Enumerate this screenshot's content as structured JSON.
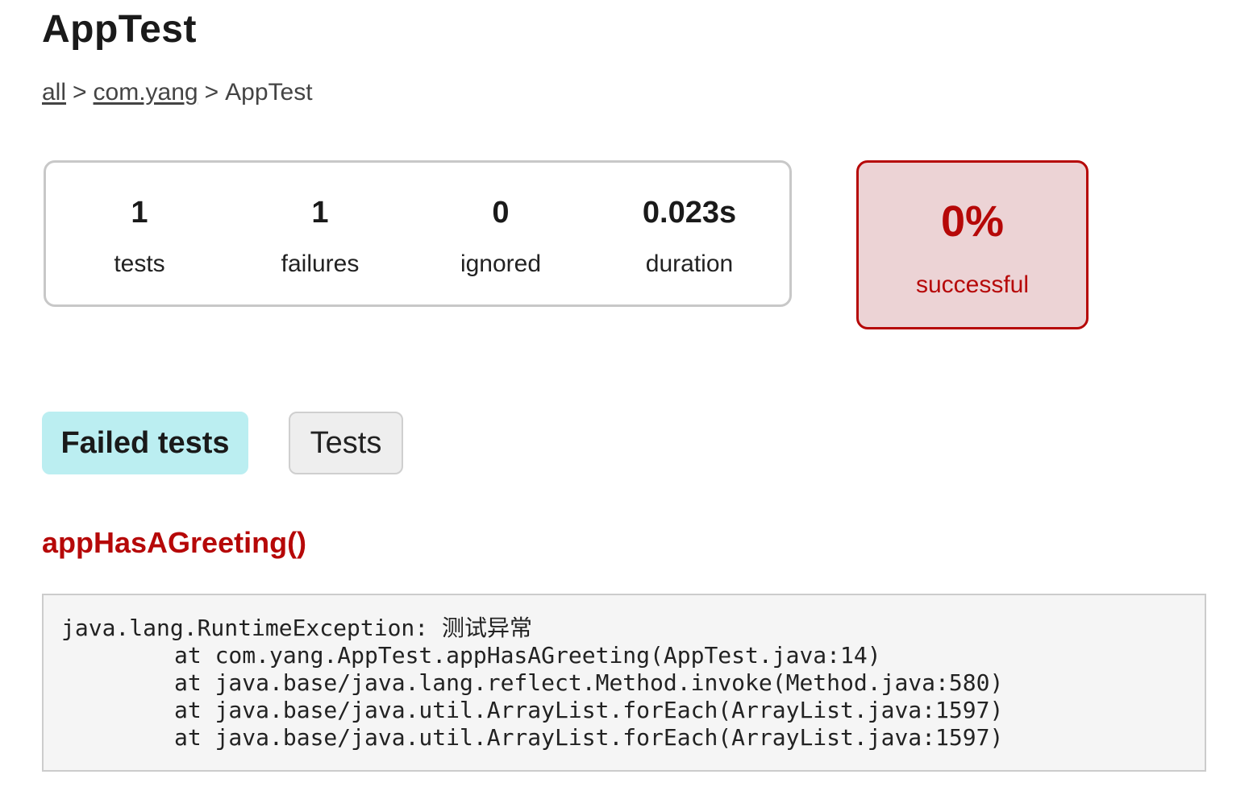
{
  "page": {
    "title": "AppTest"
  },
  "breadcrumb": {
    "items": [
      {
        "label": "all",
        "link": true
      },
      {
        "label": "com.yang",
        "link": true
      },
      {
        "label": "AppTest",
        "link": false
      }
    ],
    "separator": ">"
  },
  "summary": {
    "counters": [
      {
        "value": "1",
        "label": "tests"
      },
      {
        "value": "1",
        "label": "failures"
      },
      {
        "value": "0",
        "label": "ignored"
      },
      {
        "value": "0.023s",
        "label": "duration"
      }
    ],
    "success_rate": {
      "value": "0%",
      "label": "successful"
    }
  },
  "tabs": [
    {
      "label": "Failed tests",
      "active": true
    },
    {
      "label": "Tests",
      "active": false
    }
  ],
  "failed_test": {
    "name": "appHasAGreeting()",
    "stacktrace": {
      "exception": "java.lang.RuntimeException: 测试异常",
      "frames": [
        "at com.yang.AppTest.appHasAGreeting(AppTest.java:14)",
        "at java.base/java.lang.reflect.Method.invoke(Method.java:580)",
        "at java.base/java.util.ArrayList.forEach(ArrayList.java:1597)",
        "at java.base/java.util.ArrayList.forEach(ArrayList.java:1597)"
      ]
    }
  },
  "colors": {
    "failure_red": "#b60808",
    "failure_bg": "#ecd3d5",
    "active_tab_bg": "#bbeef1",
    "inactive_tab_bg": "#eeeeee",
    "code_bg": "#f5f5f5"
  }
}
